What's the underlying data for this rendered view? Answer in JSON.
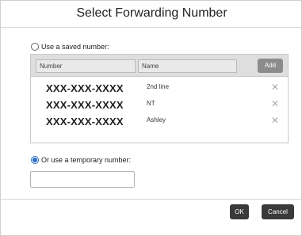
{
  "dialog": {
    "title": "Select Forwarding Number",
    "saved_option_label": "Use a saved number:",
    "temporary_option_label": "Or use a temporary number:",
    "selected_option": "temporary"
  },
  "table": {
    "columns": [
      "Number",
      "Name"
    ],
    "add_label": "Add",
    "delete_icon": "close-icon",
    "rows": [
      {
        "number": "XXX-XXX-XXXX",
        "name": "2nd line"
      },
      {
        "number": "XXX-XXX-XXXX",
        "name": "NT"
      },
      {
        "number": "XXX-XXX-XXXX",
        "name": "Ashley"
      }
    ]
  },
  "temporary_input": {
    "value": "",
    "placeholder": ""
  },
  "footer": {
    "ok_label": "OK",
    "cancel_label": "Cancel"
  },
  "colors": {
    "accent": "#2b6cc4",
    "dark_button": "#3a3a3a",
    "add_button": "#8c8c8c"
  }
}
